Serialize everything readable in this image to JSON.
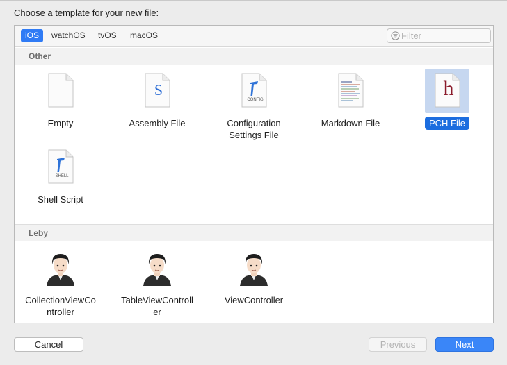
{
  "dialog": {
    "prompt": "Choose a template for your new file:"
  },
  "platform_tabs": [
    {
      "label": "iOS",
      "active": true
    },
    {
      "label": "watchOS",
      "active": false
    },
    {
      "label": "tvOS",
      "active": false
    },
    {
      "label": "macOS",
      "active": false
    }
  ],
  "filter": {
    "placeholder": "Filter",
    "value": ""
  },
  "sections": [
    {
      "title": "Other",
      "items": [
        {
          "label": "Empty",
          "icon": "blank-document-icon"
        },
        {
          "label": "Assembly File",
          "icon": "assembly-file-icon",
          "glyph": "S"
        },
        {
          "label": "Configuration\nSettings File",
          "icon": "config-file-icon",
          "caption": "CONFIG"
        },
        {
          "label": "Markdown File",
          "icon": "markdown-file-icon"
        },
        {
          "label": "PCH File",
          "icon": "pch-file-icon",
          "glyph": "h",
          "selected": true
        },
        {
          "label": "Shell Script",
          "icon": "shell-script-icon",
          "caption": "SHELL"
        }
      ]
    },
    {
      "title": "Leby",
      "items": [
        {
          "label": "CollectionViewCo\nntroller",
          "icon": "avatar-template-icon"
        },
        {
          "label": "TableViewControll\ner",
          "icon": "avatar-template-icon"
        },
        {
          "label": "ViewController",
          "icon": "avatar-template-icon"
        }
      ]
    }
  ],
  "buttons": {
    "cancel": "Cancel",
    "previous": "Previous",
    "next": "Next"
  },
  "colors": {
    "accent": "#1c6ddf",
    "selection_bg": "#c6d7f0",
    "assembly_blue": "#2f6fd6",
    "pch_red": "#8a1a2a"
  }
}
